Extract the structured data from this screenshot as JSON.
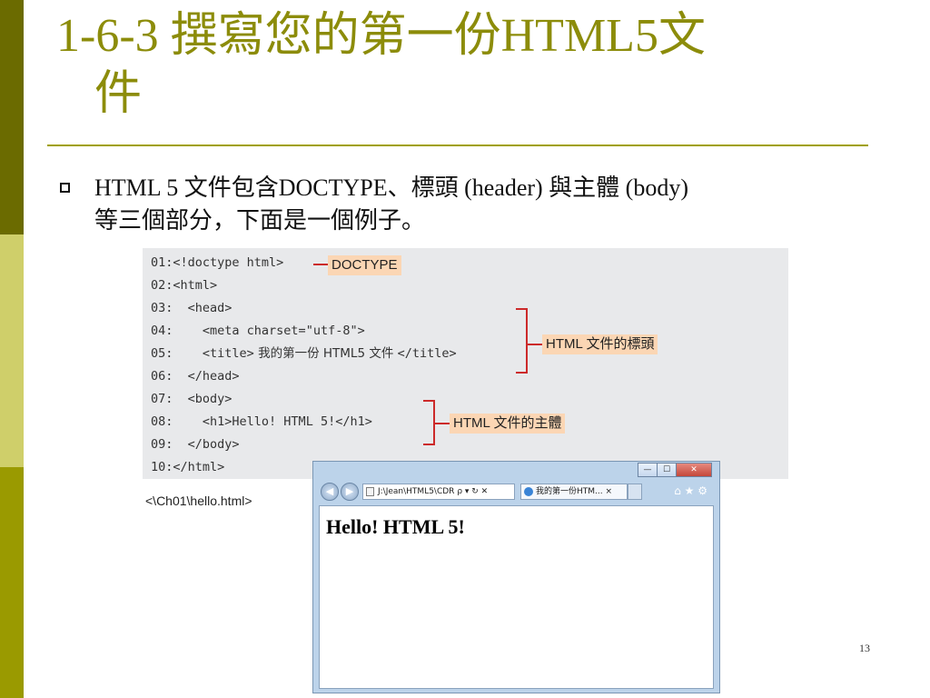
{
  "slide": {
    "title_line1": "1-6-3 撰寫您的第一份HTML5文",
    "title_line2": "件",
    "bullet_line1": "HTML 5 文件包含DOCTYPE、標頭 (header) 與主體 (body)",
    "bullet_line2": "等三個部分，下面是一個例子。",
    "page_number": "13"
  },
  "code": {
    "lines": [
      {
        "no": "01:",
        "text": "<!doctype html>"
      },
      {
        "no": "02:",
        "text": "<html>"
      },
      {
        "no": "03:",
        "text": "  <head>"
      },
      {
        "no": "04:",
        "text": "    <meta charset=\"utf-8\">"
      },
      {
        "no": "05:",
        "text_a": "    <title>",
        "text_b": " 我的第一份 HTML5 文件 ",
        "text_c": "</title>"
      },
      {
        "no": "06:",
        "text": "  </head>"
      },
      {
        "no": "07:",
        "text": "  <body>"
      },
      {
        "no": "08:",
        "text": "    <h1>Hello! HTML 5!</h1>"
      },
      {
        "no": "09:",
        "text": "  </body>"
      },
      {
        "no": "10:",
        "text": "</html>"
      }
    ],
    "file_caption": "<\\Ch01\\hello.html>"
  },
  "annotations": {
    "doctype": "DOCTYPE",
    "header": "HTML 文件的標頭",
    "body": "HTML 文件的主體"
  },
  "browser": {
    "address": "J:\\Jean\\HTML5\\CDR",
    "address_icons": "ρ ▾ ↻ ✕",
    "tab_title": "我的第一份HTM...",
    "tab_close": "×",
    "tool_icons": "⌂ ★ ⚙",
    "back": "◀",
    "forward": "▶",
    "minimize": "—",
    "maximize": "☐",
    "close": "✕",
    "content_h1": "Hello! HTML 5!"
  }
}
